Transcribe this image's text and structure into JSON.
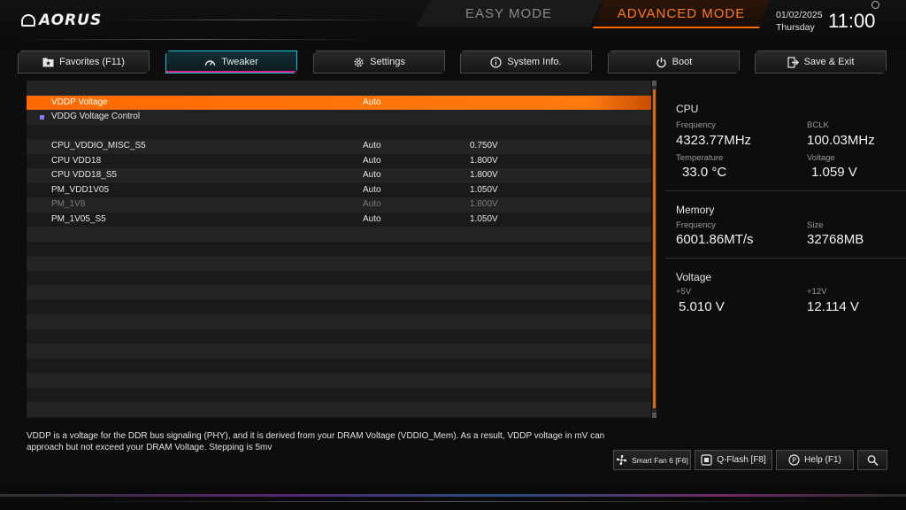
{
  "header": {
    "brand": "AORUS",
    "easy_mode": "EASY MODE",
    "advanced_mode": "ADVANCED MODE",
    "date": "01/02/2025",
    "weekday": "Thursday",
    "time": "11:00"
  },
  "tabs": [
    {
      "label": "Favorites (F11)",
      "icon": "star-folder-icon"
    },
    {
      "label": "Tweaker",
      "icon": "gauge-icon"
    },
    {
      "label": "Settings",
      "icon": "gear-icon"
    },
    {
      "label": "System Info.",
      "icon": "info-icon"
    },
    {
      "label": "Boot",
      "icon": "power-icon"
    },
    {
      "label": "Save & Exit",
      "icon": "exit-icon"
    }
  ],
  "rows": [
    {
      "name": "VDDP Voltage",
      "setting": "Auto",
      "value": ""
    },
    {
      "name": "VDDG Voltage Control",
      "setting": "",
      "value": ""
    },
    {
      "name": "",
      "setting": "",
      "value": ""
    },
    {
      "name": "CPU_VDDIO_MISC_S5",
      "setting": "Auto",
      "value": "0.750V"
    },
    {
      "name": "CPU VDD18",
      "setting": "Auto",
      "value": "1.800V"
    },
    {
      "name": "CPU VDD18_S5",
      "setting": "Auto",
      "value": "1.800V"
    },
    {
      "name": "PM_VDD1V05",
      "setting": "Auto",
      "value": "1.050V"
    },
    {
      "name": "PM_1V8",
      "setting": "Auto",
      "value": "1.800V"
    },
    {
      "name": "PM_1V05_S5",
      "setting": "Auto",
      "value": "1.050V"
    }
  ],
  "cpu": {
    "title": "CPU",
    "freq_label": "Frequency",
    "freq": "4323.77MHz",
    "bclk_label": "BCLK",
    "bclk": "100.03MHz",
    "temp_label": "Temperature",
    "temp": "33.0 °C",
    "volt_label": "Voltage",
    "volt": "1.059 V"
  },
  "memory": {
    "title": "Memory",
    "freq_label": "Frequency",
    "freq": "6001.86MT/s",
    "size_label": "Size",
    "size": "32768MB"
  },
  "voltage": {
    "title": "Voltage",
    "v5_label": "+5V",
    "v5": "5.010 V",
    "v12_label": "+12V",
    "v12": "12.114 V"
  },
  "help_text": "VDDP is a voltage for the DDR bus signaling (PHY), and it is derived from your DRAM Voltage (VDDIO_Mem). As a result, VDDP voltage in mV can approach but not exceed your DRAM Voltage. Stepping is 5mv",
  "bottom": {
    "smartfan": "Smart Fan 6 [F6]",
    "qflash": "Q-Flash [F8]",
    "help": "Help (F1)"
  }
}
